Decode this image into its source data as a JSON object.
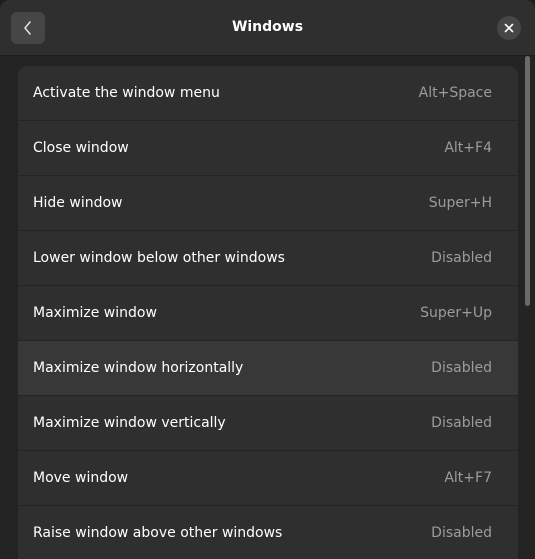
{
  "header": {
    "title": "Windows",
    "back_icon": "chevron-left-icon",
    "close_icon": "close-icon"
  },
  "shortcuts": [
    {
      "label": "Activate the window menu",
      "shortcut": "Alt+Space"
    },
    {
      "label": "Close window",
      "shortcut": "Alt+F4"
    },
    {
      "label": "Hide window",
      "shortcut": "Super+H"
    },
    {
      "label": "Lower window below other windows",
      "shortcut": "Disabled"
    },
    {
      "label": "Maximize window",
      "shortcut": "Super+Up"
    },
    {
      "label": "Maximize window horizontally",
      "shortcut": "Disabled"
    },
    {
      "label": "Maximize window vertically",
      "shortcut": "Disabled"
    },
    {
      "label": "Move window",
      "shortcut": "Alt+F7"
    },
    {
      "label": "Raise window above other windows",
      "shortcut": "Disabled"
    }
  ],
  "colors": {
    "background": "#242424",
    "row": "#2f2f2f",
    "row_hover": "#383838",
    "shortcut_text": "#9c9c9c"
  }
}
